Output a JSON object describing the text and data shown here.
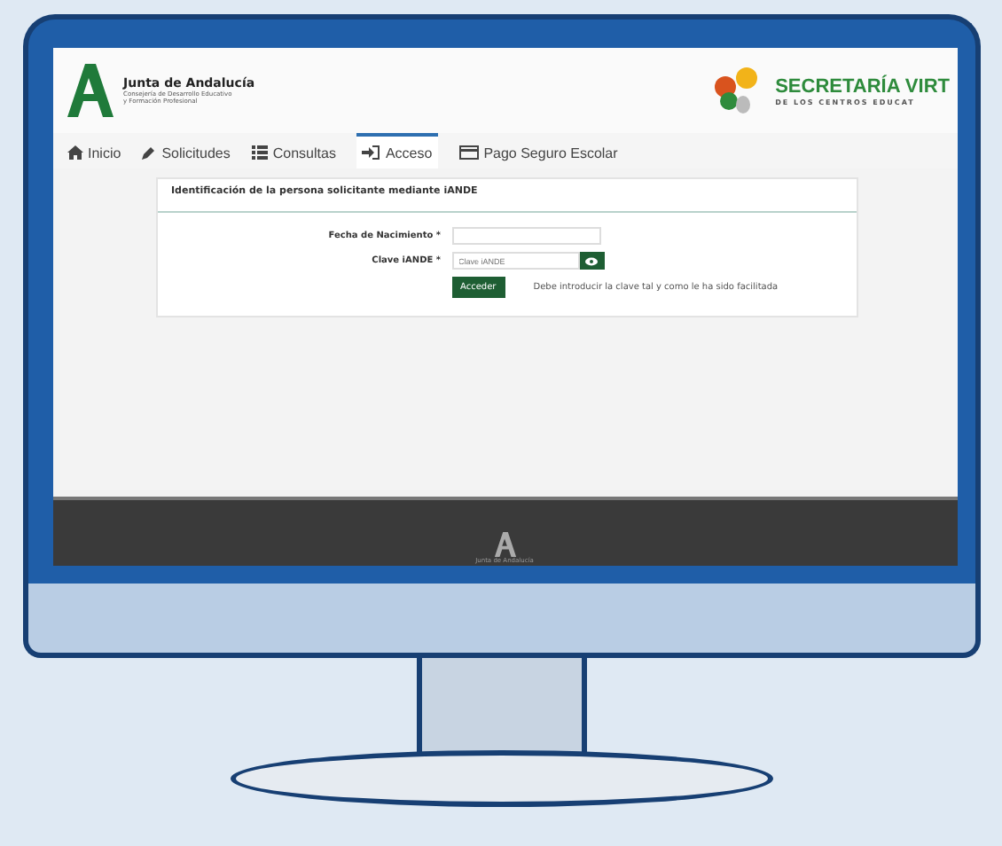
{
  "header": {
    "org_name": "Junta de Andalucía",
    "org_subtitle_lines": [
      "Consejería de Desarrollo Educativo",
      "y Formación Profesional"
    ],
    "brand_title": "SECRETARÍA VIRT",
    "brand_subtitle": "DE LOS CENTROS EDUCAT"
  },
  "nav": [
    {
      "label": "Inicio",
      "kind": "home",
      "selected": false
    },
    {
      "label": "Solicitudes",
      "kind": "pencil",
      "selected": false
    },
    {
      "label": "Consultas",
      "kind": "list",
      "selected": false
    },
    {
      "label": "Acceso",
      "kind": "login",
      "selected": true
    },
    {
      "label": "Pago Seguro Escolar",
      "kind": "card",
      "selected": false
    }
  ],
  "form": {
    "title": "Identificación de la persona solicitante mediante iANDE",
    "fields": [
      {
        "label": "Fecha de Nacimiento *",
        "kind": "text"
      },
      {
        "label": "Clave iANDE *",
        "kind": "password",
        "placeholder": "Clave iANDE"
      }
    ],
    "submit": "Acceder",
    "hint": "Debe introducir la clave tal y como le ha sido facilitada"
  },
  "footer": {
    "caption": "Junta de Andalucía"
  }
}
